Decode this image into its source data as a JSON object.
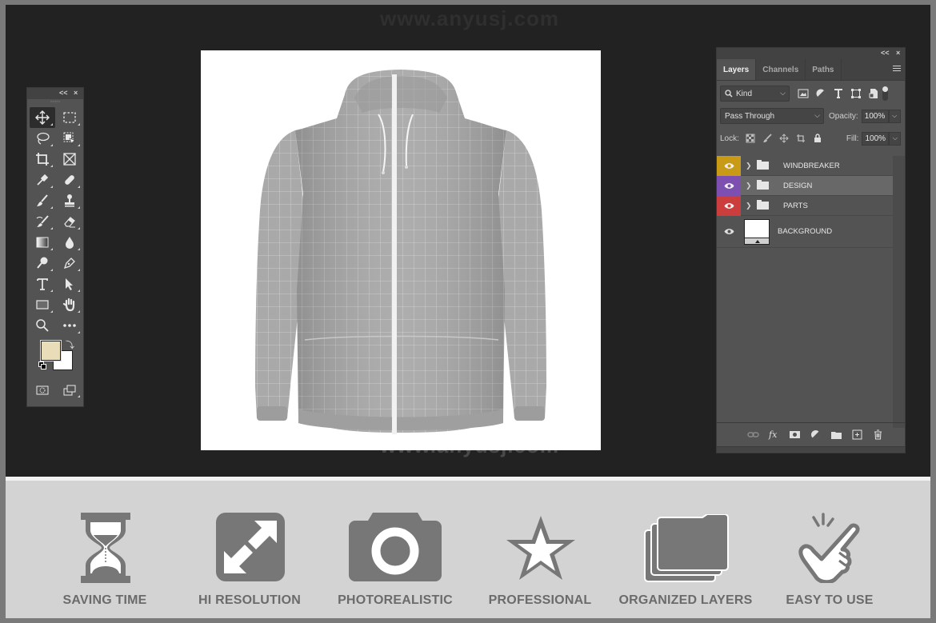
{
  "watermark": "www.anyusj.com",
  "tools_panel": {
    "collapse_label": "<<",
    "close_label": "×",
    "tools": [
      {
        "name": "move-tool",
        "icon": "move-icon",
        "active": true
      },
      {
        "name": "rectangular-marquee-tool",
        "icon": "marquee-icon"
      },
      {
        "name": "lasso-tool",
        "icon": "lasso-icon"
      },
      {
        "name": "object-selection-tool",
        "icon": "object-selection-icon"
      },
      {
        "name": "crop-tool",
        "icon": "crop-icon"
      },
      {
        "name": "frame-tool",
        "icon": "frame-icon"
      },
      {
        "name": "eyedropper-tool",
        "icon": "eyedropper-icon"
      },
      {
        "name": "healing-brush-tool",
        "icon": "bandage-icon"
      },
      {
        "name": "brush-tool",
        "icon": "brush-icon"
      },
      {
        "name": "clone-stamp-tool",
        "icon": "stamp-icon"
      },
      {
        "name": "history-brush-tool",
        "icon": "history-brush-icon"
      },
      {
        "name": "eraser-tool",
        "icon": "eraser-icon"
      },
      {
        "name": "gradient-tool",
        "icon": "gradient-icon"
      },
      {
        "name": "blur-tool",
        "icon": "drop-icon"
      },
      {
        "name": "dodge-tool",
        "icon": "dodge-icon"
      },
      {
        "name": "pen-tool",
        "icon": "pen-icon"
      },
      {
        "name": "type-tool",
        "icon": "type-icon"
      },
      {
        "name": "path-selection-tool",
        "icon": "arrow-icon"
      },
      {
        "name": "rectangle-tool",
        "icon": "rectangle-icon"
      },
      {
        "name": "hand-tool",
        "icon": "hand-icon"
      },
      {
        "name": "zoom-tool",
        "icon": "magnifier-icon"
      },
      {
        "name": "more-tools",
        "icon": "ellipsis-icon"
      }
    ],
    "foreground_color": "#e8dcb9",
    "background_color": "#ffffff"
  },
  "layers_panel": {
    "collapse_label": "<<",
    "close_label": "×",
    "tabs": [
      {
        "label": "Layers",
        "active": true
      },
      {
        "label": "Channels",
        "active": false
      },
      {
        "label": "Paths",
        "active": false
      }
    ],
    "filter": {
      "label": "Kind"
    },
    "blend_mode": "Pass Through",
    "opacity_label": "Opacity:",
    "opacity_value": "100%",
    "lock_label": "Lock:",
    "fill_label": "Fill:",
    "fill_value": "100%",
    "layers": [
      {
        "name": "WINDBREAKER",
        "type": "group",
        "color": "#c99a16",
        "selected": false
      },
      {
        "name": "DESIGN",
        "type": "group",
        "color": "#7d4fb1",
        "selected": true
      },
      {
        "name": "PARTS",
        "type": "group",
        "color": "#cc3d3d",
        "selected": false
      },
      {
        "name": "BACKGROUND",
        "type": "layer",
        "color": null,
        "selected": false
      }
    ],
    "footer_icons": [
      "link-icon",
      "fx-icon",
      "mask-icon",
      "adjustment-icon",
      "new-group-icon",
      "new-layer-icon",
      "trash-icon"
    ]
  },
  "features": [
    {
      "label": "SAVING TIME",
      "icon": "hourglass-icon"
    },
    {
      "label": "HI RESOLUTION",
      "icon": "expand-arrows-icon"
    },
    {
      "label": "PHOTOREALISTIC",
      "icon": "camera-icon"
    },
    {
      "label": "PROFESSIONAL",
      "icon": "star-icon"
    },
    {
      "label": "ORGANIZED LAYERS",
      "icon": "folders-icon"
    },
    {
      "label": "EASY TO USE",
      "icon": "pointing-hand-icon"
    }
  ]
}
